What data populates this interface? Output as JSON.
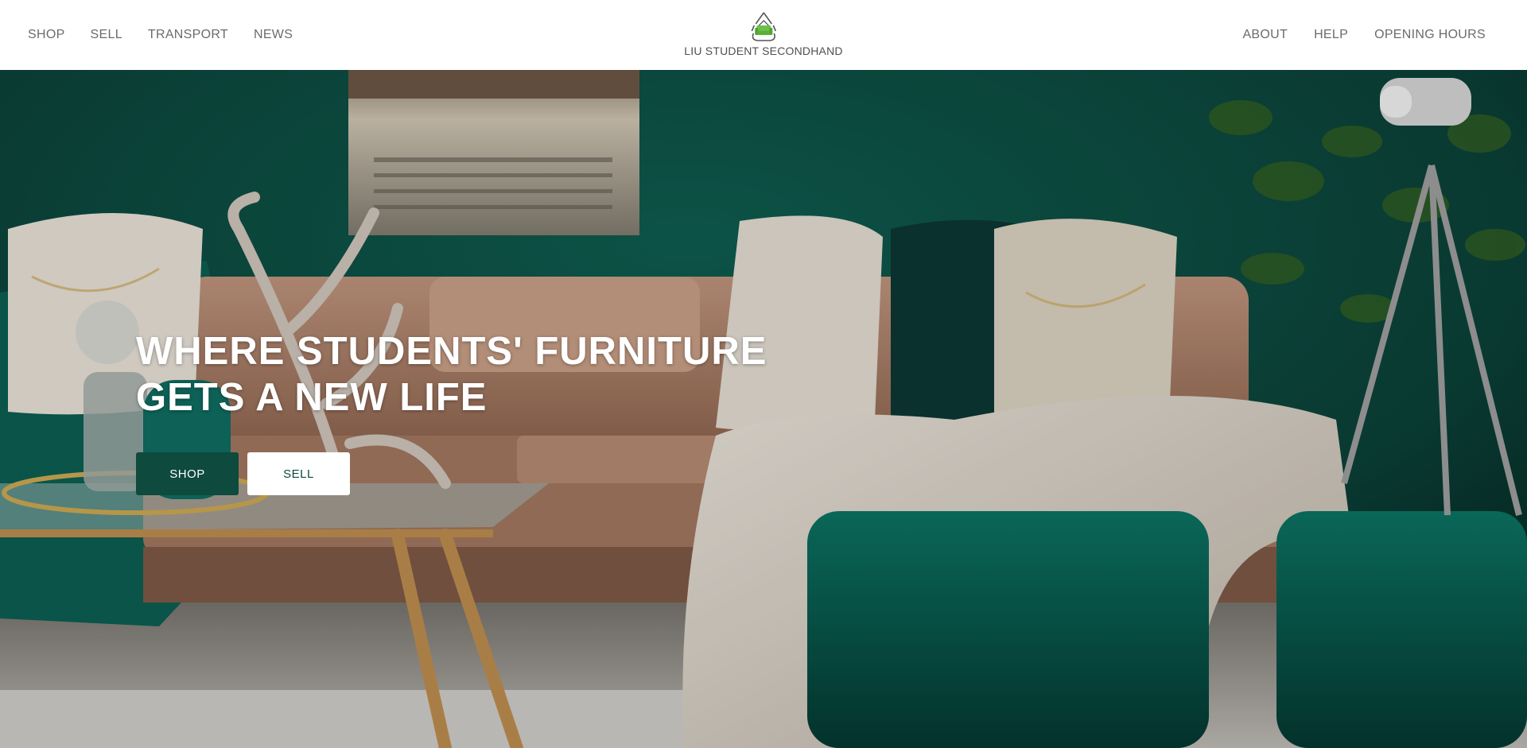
{
  "header": {
    "nav_left": [
      {
        "label": "SHOP"
      },
      {
        "label": "SELL"
      },
      {
        "label": "TRANSPORT"
      },
      {
        "label": "NEWS"
      }
    ],
    "logo_text": "LIU STUDENT SECONDHAND",
    "nav_right": [
      {
        "label": "ABOUT"
      },
      {
        "label": "HELP"
      },
      {
        "label": "OPENING HOURS"
      }
    ]
  },
  "hero": {
    "title_line1": "WHERE STUDENTS' FURNITURE",
    "title_line2": "GETS A NEW LIFE",
    "shop_button": "SHOP",
    "sell_button": "SELL"
  },
  "colors": {
    "accent": "#0e4a3d",
    "nav_text": "#6b6b6b",
    "logo_green": "#6cc04a"
  }
}
